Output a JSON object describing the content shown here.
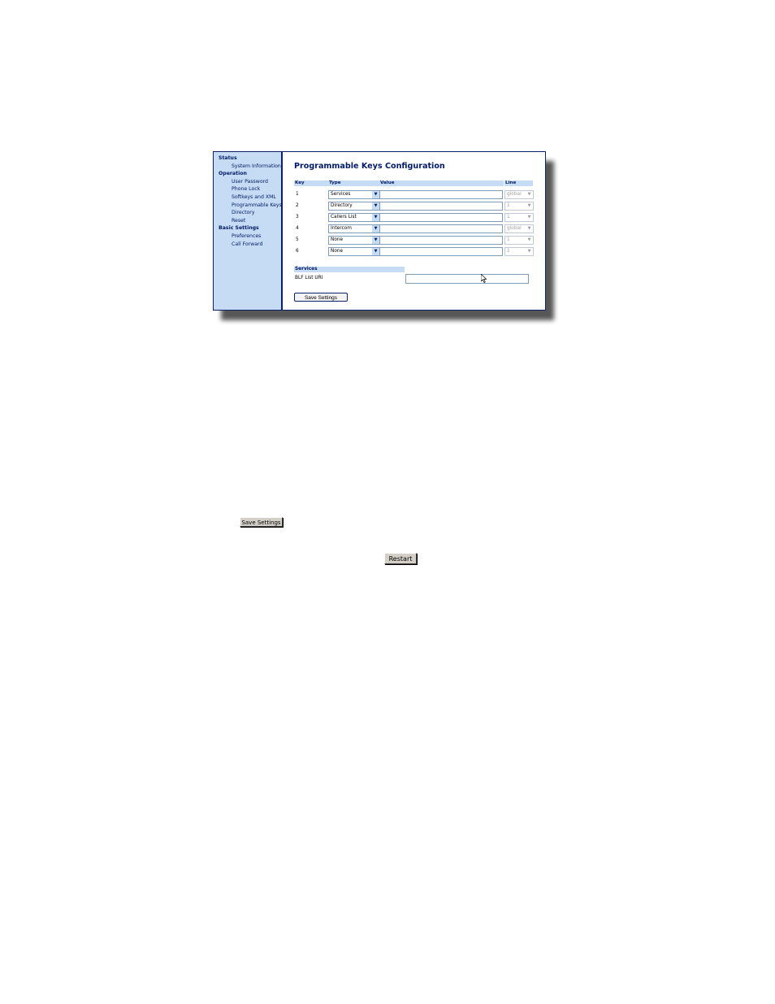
{
  "sidebar": {
    "sections": [
      {
        "title": "Status",
        "items": [
          "System Information"
        ]
      },
      {
        "title": "Operation",
        "items": [
          "User Password",
          "Phone Lock",
          "Softkeys and XML",
          "Programmable Keys",
          "Directory",
          "Reset"
        ]
      },
      {
        "title": "Basic Settings",
        "items": [
          "Preferences",
          "Call Forward"
        ]
      }
    ]
  },
  "main": {
    "title": "Programmable Keys Configuration",
    "columns": {
      "key": "Key",
      "type": "Type",
      "value": "Value",
      "line": "Line"
    },
    "rows": [
      {
        "key": "1",
        "type": "Services",
        "value": "",
        "line": "global"
      },
      {
        "key": "2",
        "type": "Directory",
        "value": "",
        "line": "1"
      },
      {
        "key": "3",
        "type": "Callers List",
        "value": "",
        "line": "1"
      },
      {
        "key": "4",
        "type": "Intercom",
        "value": "",
        "line": "global"
      },
      {
        "key": "5",
        "type": "None",
        "value": "",
        "line": "1"
      },
      {
        "key": "6",
        "type": "None",
        "value": "",
        "line": "1"
      }
    ],
    "services": {
      "header": "Services",
      "blf_label": "BLF List URI",
      "blf_value": ""
    },
    "save_label": "Save Settings"
  },
  "standalone_buttons": {
    "save_settings": "Save Settings",
    "restart": "Restart"
  },
  "colors": {
    "sidebar_bg": "#c6dcf4",
    "accent": "#001a66",
    "border": "#0b1f6b"
  }
}
